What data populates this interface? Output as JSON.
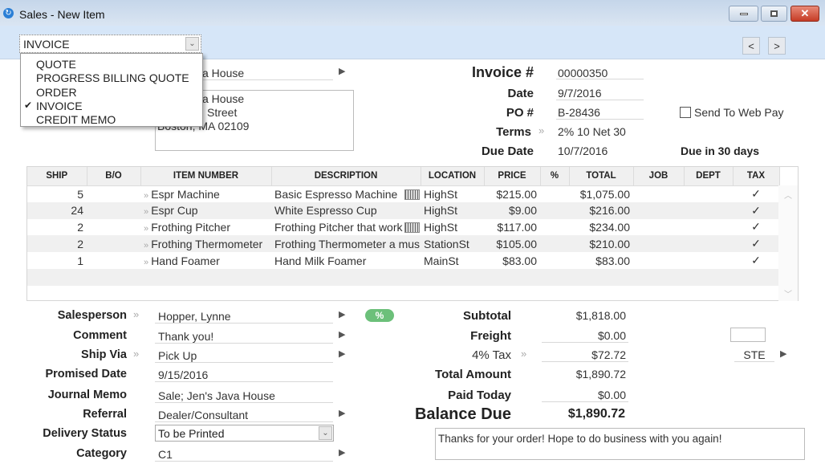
{
  "window": {
    "title": "Sales - New Item",
    "app_icon": "refresh-circle-icon",
    "minimize": "minimize-icon",
    "maximize": "maximize-icon",
    "close": "close-icon"
  },
  "toolbar": {
    "type_select": "INVOICE",
    "prev": "<",
    "next": ">"
  },
  "type_menu": {
    "items": [
      {
        "label": "QUOTE",
        "checked": false
      },
      {
        "label": "PROGRESS BILLING QUOTE",
        "checked": false
      },
      {
        "label": "ORDER",
        "checked": false
      },
      {
        "label": "INVOICE",
        "checked": true
      },
      {
        "label": "CREDIT MEMO",
        "checked": false
      }
    ],
    "check": "✔"
  },
  "customer": {
    "name_visible": "a House",
    "address_lines_visible": [
      "a House",
      "Street",
      "Boston, MA 02109"
    ]
  },
  "header": {
    "invoice_label": "Invoice #",
    "invoice_no": "00000350",
    "date_label": "Date",
    "date": "9/7/2016",
    "po_label": "PO #",
    "po": "B-28436",
    "terms_label": "Terms",
    "terms": "2% 10 Net 30",
    "due_label": "Due Date",
    "due_date": "10/7/2016",
    "web_pay": "Send To Web Pay",
    "web_pay_checked": false,
    "due_in": "Due in 30 days"
  },
  "grid": {
    "columns": [
      "SHIP",
      "B/O",
      "ITEM NUMBER",
      "DESCRIPTION",
      "LOCATION",
      "PRICE",
      "%",
      "TOTAL",
      "JOB",
      "DEPT",
      "TAX"
    ],
    "rows": [
      {
        "ship": "5",
        "bo": "",
        "item": "Espr Machine",
        "desc": "Basic Espresso Machine",
        "loc": "HighSt",
        "price": "$215.00",
        "pct": "",
        "total": "$1,075.00",
        "job": "",
        "dept": "",
        "tax": "✓",
        "note": true
      },
      {
        "ship": "24",
        "bo": "",
        "item": "Espr Cup",
        "desc": "White Espresso Cup",
        "loc": "HighSt",
        "price": "$9.00",
        "pct": "",
        "total": "$216.00",
        "job": "",
        "dept": "",
        "tax": "✓",
        "note": false
      },
      {
        "ship": "2",
        "bo": "",
        "item": "Frothing Pitcher",
        "desc": "Frothing Pitcher that work",
        "loc": "HighSt",
        "price": "$117.00",
        "pct": "",
        "total": "$234.00",
        "job": "",
        "dept": "",
        "tax": "✓",
        "note": true
      },
      {
        "ship": "2",
        "bo": "",
        "item": "Frothing Thermometer",
        "desc": "Frothing Thermometer a mus",
        "loc": "StationSt",
        "price": "$105.00",
        "pct": "",
        "total": "$210.00",
        "job": "",
        "dept": "",
        "tax": "✓",
        "note": false
      },
      {
        "ship": "1",
        "bo": "",
        "item": "Hand Foamer",
        "desc": "Hand Milk Foamer",
        "loc": "MainSt",
        "price": "$83.00",
        "pct": "",
        "total": "$83.00",
        "job": "",
        "dept": "",
        "tax": "✓",
        "note": false
      }
    ]
  },
  "details": [
    {
      "label": "Salesperson",
      "value": "Hopper, Lynne",
      "lookup": true,
      "arrow": true
    },
    {
      "label": "Comment",
      "value": "Thank you!",
      "lookup": false,
      "arrow": true
    },
    {
      "label": "Ship Via",
      "value": "Pick Up",
      "lookup": true,
      "arrow": true
    },
    {
      "label": "Promised Date",
      "value": "9/15/2016",
      "lookup": false,
      "arrow": false
    },
    {
      "label": "Journal Memo",
      "value": "Sale; Jen's Java House",
      "lookup": false,
      "arrow": false
    },
    {
      "label": "Referral",
      "value": "Dealer/Consultant",
      "lookup": false,
      "arrow": true
    },
    {
      "label": "Delivery Status",
      "value": "To be Printed",
      "lookup": false,
      "arrow": false,
      "select": true
    },
    {
      "label": "Category",
      "value": "C1",
      "lookup": false,
      "arrow": true
    }
  ],
  "discount_pill": "%",
  "totals": {
    "subtotal_label": "Subtotal",
    "subtotal": "$1,818.00",
    "freight_label": "Freight",
    "freight": "$0.00",
    "tax_label": "4% Tax",
    "tax": "$72.72",
    "tax_code": "STE",
    "total_label": "Total Amount",
    "total": "$1,890.72",
    "paid_label": "Paid Today",
    "paid": "$0.00",
    "balance_label": "Balance Due",
    "balance": "$1,890.72"
  },
  "invoice_message": "Thanks for your order! Hope to do business with you again!",
  "colors": {
    "titlebar": "#c5d6ea",
    "toolbar": "#d6e6f8",
    "close": "#d0452f",
    "pill": "#6cc07a"
  }
}
